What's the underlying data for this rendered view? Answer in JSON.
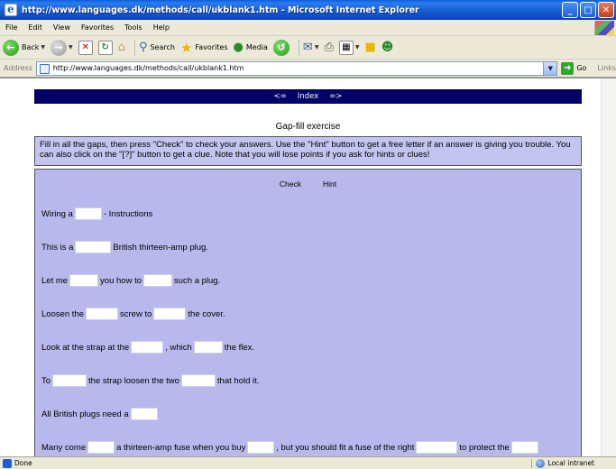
{
  "window": {
    "title": "http://www.languages.dk/methods/call/ukblank1.htm - Microsoft Internet Explorer",
    "minimize": "_",
    "maximize": "□",
    "close": "✕"
  },
  "menu": [
    "File",
    "Edit",
    "View",
    "Favorites",
    "Tools",
    "Help"
  ],
  "toolbar": {
    "back": "Back",
    "search": "Search",
    "favorites": "Favorites",
    "media": "Media"
  },
  "address": {
    "label": "Address",
    "url": "http://www.languages.dk/methods/call/ukblank1.htm",
    "go": "Go",
    "links": "Links"
  },
  "page": {
    "nav": {
      "prev": "<=",
      "index": "Index",
      "next": "=>"
    },
    "title": "Gap-fill exercise",
    "instructions": "Fill in all the gaps, then press \"Check\" to check your answers. Use the \"Hint\" button to get a free letter if an answer is giving you trouble. You can also click on the \"[?]\" button to get a clue. Note that you will lose points if you ask for hints or clues!",
    "buttons": {
      "check": "Check",
      "hint": "Hint"
    },
    "lines": [
      {
        "parts": [
          "Wiring a",
          "- Instructions"
        ]
      },
      {
        "parts": [
          "This is a",
          "British thirteen-amp plug."
        ]
      },
      {
        "parts": [
          "Let me",
          "you how to",
          "such a plug."
        ]
      },
      {
        "parts": [
          "Loosen the",
          "screw to",
          "the cover."
        ]
      },
      {
        "parts": [
          "Look at the strap at the",
          ", which",
          "the flex."
        ]
      },
      {
        "parts": [
          "To",
          "the strap loosen the two",
          "that hold it."
        ]
      },
      {
        "parts": [
          "All British plugs need a",
          ""
        ]
      },
      {
        "parts": [
          "Many come",
          "a thirteen-amp fuse when you buy",
          ", but you should fit a fuse of the right",
          "to protect the",
          ""
        ]
      }
    ]
  },
  "status": {
    "left": "Done",
    "zone": "Local intranet"
  }
}
